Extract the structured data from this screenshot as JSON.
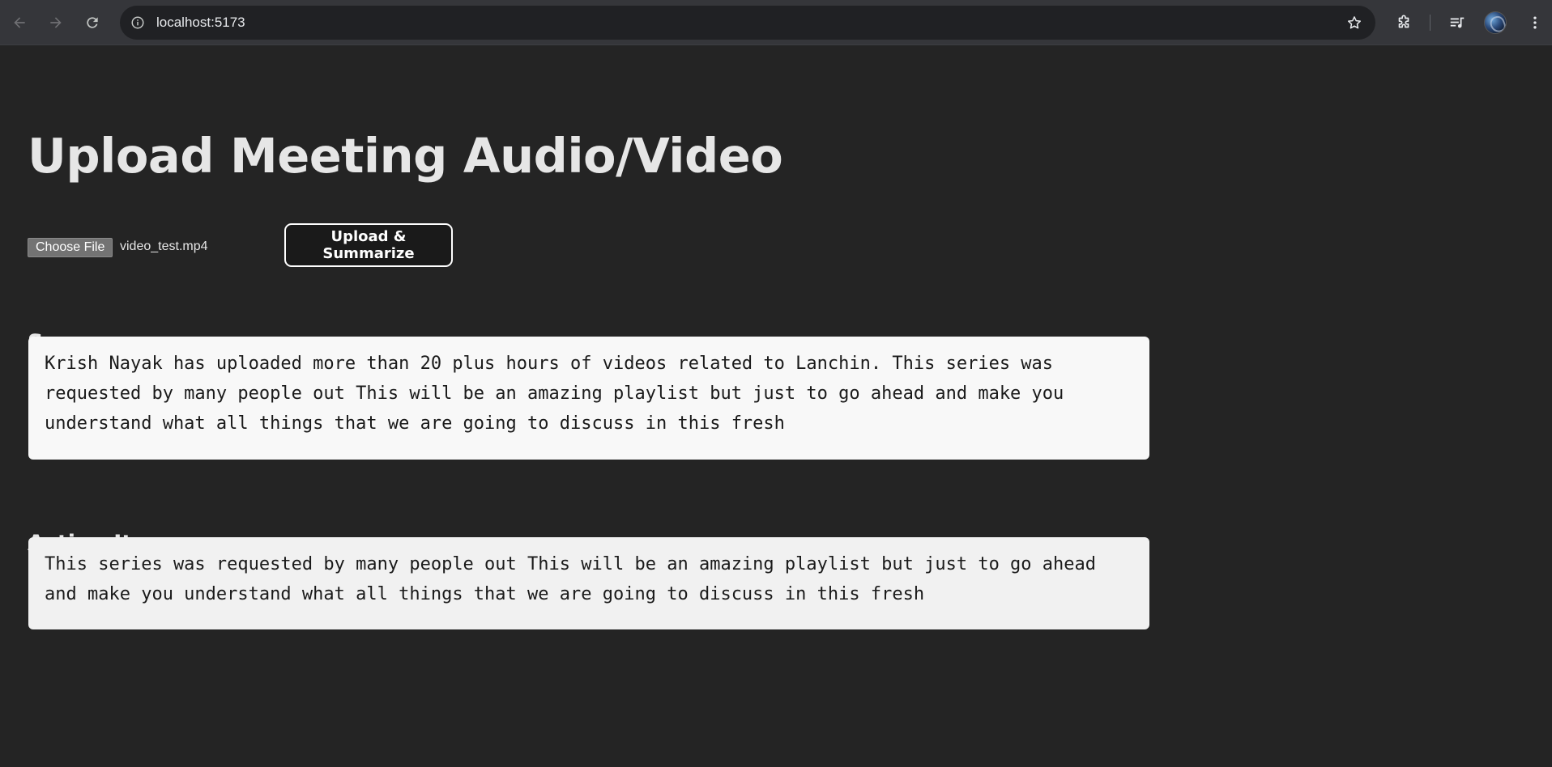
{
  "browser": {
    "url": "localhost:5173",
    "icons": {
      "back": "arrow-left-icon",
      "forward": "arrow-right-icon",
      "reload": "reload-icon",
      "site_info": "info-icon",
      "bookmark": "star-icon",
      "extensions": "puzzle-icon",
      "media": "media-queue-icon",
      "menu": "kebab-menu-icon"
    }
  },
  "page": {
    "title": "Upload Meeting Audio/Video",
    "file_input": {
      "button_label": "Choose File",
      "file_name": "video_test.mp4"
    },
    "upload_button_label": "Upload & Summarize",
    "summary": {
      "heading": "Summary:",
      "text": "Krish Nayak has uploaded more than 20 plus hours of videos related to Lanchin. This series was requested by many people out This will be an amazing playlist but just to go ahead and make you understand what all things that we are going to discuss in this fresh"
    },
    "action_items": {
      "heading": "Action Items:",
      "text": "This series was requested by many people out This will be an amazing playlist but just to go ahead and make you understand what all things that we are going to discuss in this fresh"
    }
  },
  "colors": {
    "page_background": "#242424",
    "chrome_background": "#35363a",
    "omnibox_background": "#202124",
    "heading_text": "#e6e6e6",
    "box_background": "#f8f8f8",
    "button_background": "#1a1a1a"
  }
}
